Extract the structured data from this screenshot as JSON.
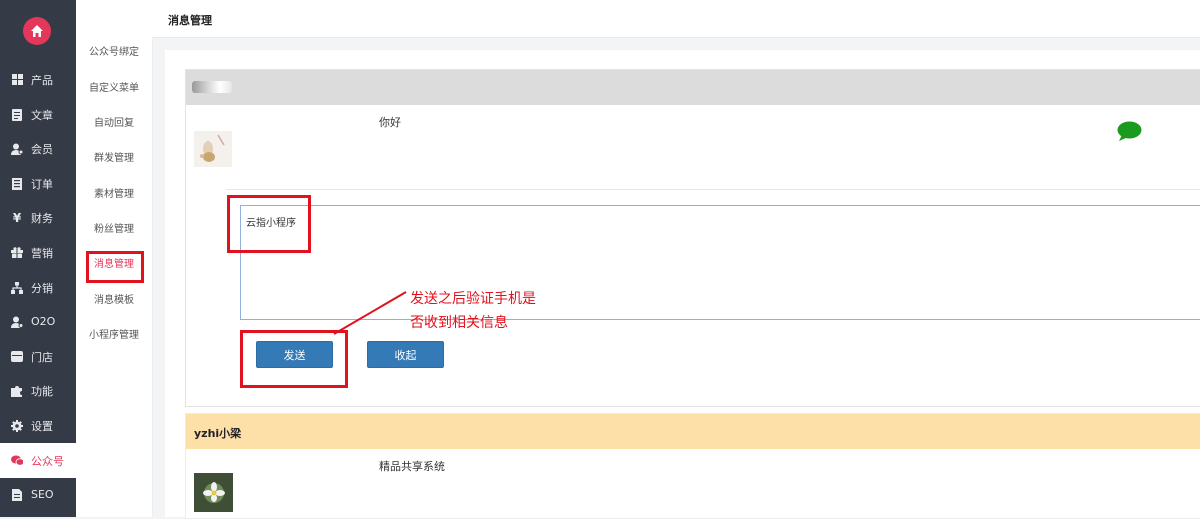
{
  "colors": {
    "accent": "#e5375a",
    "sidebar_bg": "#353a47",
    "button": "#337ab7",
    "annotation_red": "#e0121d",
    "chat_icon": "#1a9b1f",
    "second_header": "#fddfa8"
  },
  "sidebar": {
    "logo_icon": "home-icon",
    "items": [
      {
        "label": "产品",
        "icon": "grid-icon"
      },
      {
        "label": "文章",
        "icon": "document-icon"
      },
      {
        "label": "会员",
        "icon": "user-icon"
      },
      {
        "label": "订单",
        "icon": "list-icon"
      },
      {
        "label": "财务",
        "icon": "yen-icon"
      },
      {
        "label": "营销",
        "icon": "gift-icon"
      },
      {
        "label": "分销",
        "icon": "sitemap-icon"
      },
      {
        "label": "O2O",
        "icon": "user-cog-icon"
      },
      {
        "label": "门店",
        "icon": "store-icon"
      },
      {
        "label": "功能",
        "icon": "puzzle-icon"
      },
      {
        "label": "设置",
        "icon": "gear-icon"
      },
      {
        "label": "公众号",
        "icon": "wechat-icon"
      },
      {
        "label": "SEO",
        "icon": "file-icon"
      }
    ]
  },
  "subnav": {
    "items": [
      "公众号绑定",
      "自定义菜单",
      "自动回复",
      "群发管理",
      "素材管理",
      "粉丝管理",
      "消息管理",
      "消息模板",
      "小程序管理"
    ]
  },
  "header": {
    "title": "消息管理"
  },
  "messages": [
    {
      "message": "你好",
      "reply_text": "云指小程序",
      "send_label": "发送",
      "collapse_label": "收起"
    },
    {
      "username": "yzhi小梁",
      "message": "精品共享系统"
    }
  ],
  "annotation": {
    "line1": "发送之后验证手机是",
    "line2": "否收到相关信息"
  }
}
